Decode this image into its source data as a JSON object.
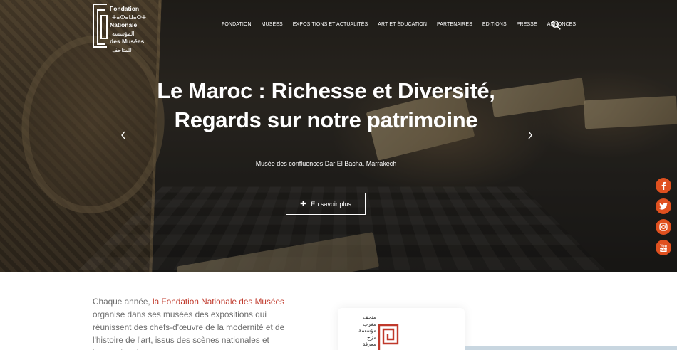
{
  "brand": {
    "name_lines": [
      "Fondation",
      "Nationale",
      "des Musées"
    ],
    "arabic_lines": [
      "المؤسسة",
      "الوطنية",
      "للمتاحف"
    ],
    "tifinagh_lines": [
      "ⵜⴰⵙⴰⵡⴰⵔⵜ",
      "ⵜⴰⵏⴰⵎⵓⵔⵜ",
      "ⵏ ⵜⵙⵎⵉⴷⴰ"
    ]
  },
  "nav": {
    "items": [
      "FONDATION",
      "MUSÉES",
      "EXPOSITIONS ET ACTUALITÉS",
      "ART ET ÉDUCATION",
      "PARTENAIRES",
      "EDITIONS",
      "PRESSE",
      "ANNONCES"
    ],
    "search_icon": "search-icon"
  },
  "hero": {
    "title_line1": "Le Maroc : Richesse et Diversité,",
    "title_line2": "Regards sur notre patrimoine",
    "subtitle": "Musée des confluences Dar El Bacha, Marrakech",
    "cta_label": "En savoir plus",
    "cta_icon": "plus-icon",
    "prev_icon": "chevron-left-icon",
    "next_icon": "chevron-right-icon"
  },
  "social": {
    "color": "#e0501f",
    "items": [
      {
        "name": "facebook",
        "glyph": "f"
      },
      {
        "name": "twitter",
        "glyph": "t"
      },
      {
        "name": "instagram",
        "glyph": "ig"
      },
      {
        "name": "youtube",
        "glyph": "You"
      }
    ]
  },
  "intro": {
    "before": "Chaque année, ",
    "highlight": "la Fondation Nationale des Musées",
    "after": " organise dans ses musées des expositions qui réunissent des chefs-d'œuvre de la modernité et de l'histoire de l'art, issus des scènes nationales et internationales.",
    "highlight_color": "#c0392b"
  },
  "card": {
    "arabic_lines": [
      "متحف",
      "مغرب",
      "مؤسسة",
      "مزج",
      "معرفة"
    ]
  }
}
